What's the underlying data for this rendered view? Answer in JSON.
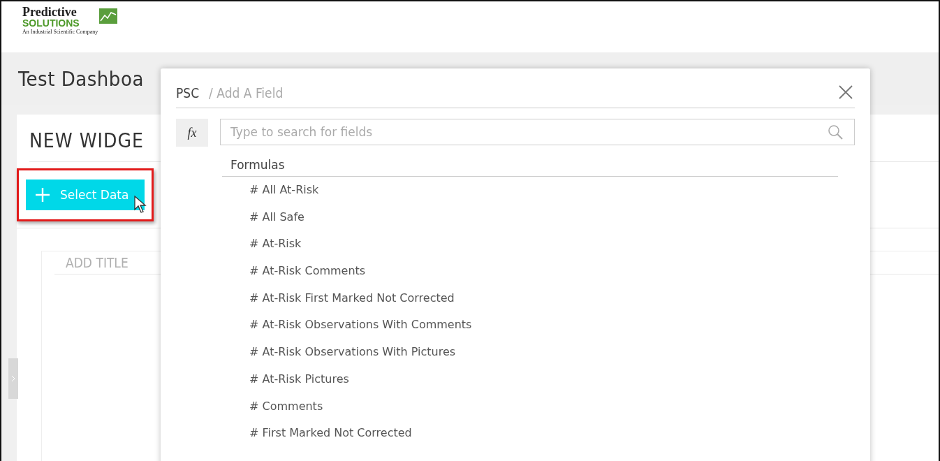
{
  "logo": {
    "line1": "Predictive",
    "line2": "SOLUTIONS",
    "tagline": "An Industrial Scientific Company"
  },
  "dashboard": {
    "title": "Test Dashboa"
  },
  "widget": {
    "title": "NEW WIDGE",
    "select_button": "Select Data",
    "highlighted": true,
    "panel_title": "ADD TITLE"
  },
  "modal": {
    "source": "PSC",
    "title": "/ Add A Field",
    "formula_button": "fx",
    "search": {
      "placeholder": "Type to search for fields"
    },
    "group": "Formulas",
    "fields": [
      {
        "label": "# All At-Risk"
      },
      {
        "label": "# All Safe"
      },
      {
        "label": "# At-Risk"
      },
      {
        "label": "# At-Risk Comments"
      },
      {
        "label": "# At-Risk First Marked Not Corrected"
      },
      {
        "label": "# At-Risk Observations With Comments"
      },
      {
        "label": "# At-Risk Observations With Pictures"
      },
      {
        "label": "# At-Risk Pictures"
      },
      {
        "label": "# Comments"
      },
      {
        "label": "# First Marked Not Corrected"
      }
    ]
  }
}
